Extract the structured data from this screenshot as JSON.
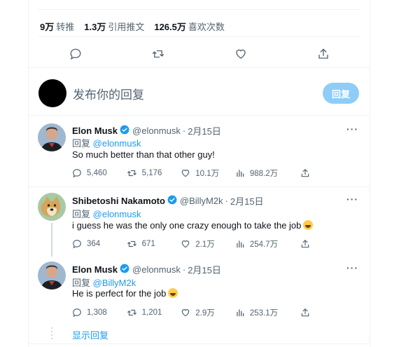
{
  "stats": {
    "retweets_count": "9万",
    "retweets_label": "转推",
    "quotes_count": "1.3万",
    "quotes_label": "引用推文",
    "likes_count": "126.5万",
    "likes_label": "喜欢次数"
  },
  "compose": {
    "placeholder": "发布你的回复",
    "reply_button": "回复"
  },
  "tweets": [
    {
      "name": "Elon Musk",
      "handle": "@elonmusk",
      "date": "2月15日",
      "reply_prefix": "回复",
      "reply_to": "@elonmusk",
      "text": "So much better than that other guy!",
      "replies": "5,460",
      "retweets": "5,176",
      "likes": "10.1万",
      "views": "988.2万"
    },
    {
      "name": "Shibetoshi Nakamoto",
      "handle": "@BillyM2k",
      "date": "2月15日",
      "reply_prefix": "回复",
      "reply_to": "@elonmusk",
      "text": "i guess he was the only one crazy enough to take the job",
      "replies": "364",
      "retweets": "671",
      "likes": "2.1万",
      "views": "254.7万"
    },
    {
      "name": "Elon Musk",
      "handle": "@elonmusk",
      "date": "2月15日",
      "reply_prefix": "回复",
      "reply_to": "@BillyM2k",
      "text": "He is perfect for the job",
      "replies": "1,308",
      "retweets": "1,201",
      "likes": "2.9万",
      "views": "253.1万"
    }
  ],
  "show_replies": "显示回复",
  "colors": {
    "accent": "#1d9bf0",
    "muted": "#536471",
    "reply_button_bg": "#8ecdf8"
  }
}
